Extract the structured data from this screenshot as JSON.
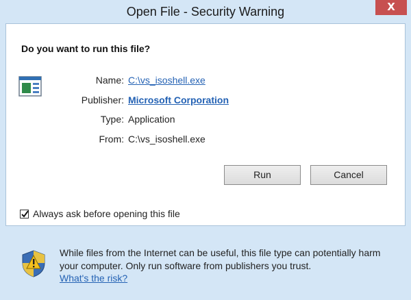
{
  "window": {
    "title": "Open File - Security Warning",
    "close_label": "X"
  },
  "dialog": {
    "question": "Do you want to run this file?",
    "fields": [
      {
        "label": "Name:",
        "value": "C:\\vs_isoshell.exe"
      },
      {
        "label": "Publisher:",
        "value": "Microsoft Corporation"
      },
      {
        "label": "Type:",
        "value": "Application"
      },
      {
        "label": "From:",
        "value": "C:\\vs_isoshell.exe"
      }
    ],
    "run_label": "Run",
    "cancel_label": "Cancel",
    "checkbox": {
      "label": "Always ask before opening this file",
      "checked": true
    }
  },
  "warning": {
    "text": "While files from the Internet can be useful, this file type can potentially harm your computer. Only run software from publishers you trust.",
    "link_label": "What's the risk?"
  },
  "colors": {
    "link": "#2462b4",
    "close": "#c75050",
    "frame": "#d4e6f6"
  }
}
